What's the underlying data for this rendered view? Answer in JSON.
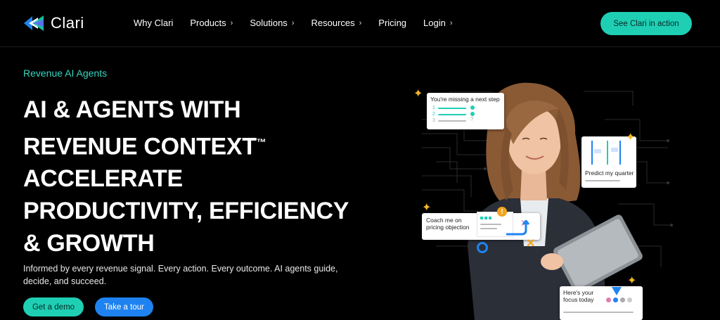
{
  "nav": {
    "logo_text": "Clari",
    "items": [
      {
        "label": "Why Clari",
        "has_chevron": false
      },
      {
        "label": "Products",
        "has_chevron": true
      },
      {
        "label": "Solutions",
        "has_chevron": true
      },
      {
        "label": "Resources",
        "has_chevron": true
      },
      {
        "label": "Pricing",
        "has_chevron": false
      },
      {
        "label": "Login",
        "has_chevron": true
      }
    ],
    "cta_label": "See Clari in action"
  },
  "hero": {
    "eyebrow": "Revenue AI Agents",
    "headline_lines": [
      "AI & AGENTS WITH",
      "REVENUE CONTEXT",
      "ACCELERATE",
      "PRODUCTIVITY, EFFICIENCY",
      "& GROWTH"
    ],
    "trademark": "™",
    "subtext": "Informed by every revenue signal. Every action. Every outcome. AI agents guide, decide, and succeed.",
    "primary_button": "Get a demo",
    "secondary_button": "Take a tour"
  },
  "visual": {
    "cards": {
      "next_step": "You're missing a next step",
      "predict": "Predict my quarter",
      "coach": "Coach me on pricing objection",
      "focus": "Here's your focus today"
    },
    "checklist_numbers": [
      "1",
      "2",
      "3"
    ],
    "question_mark": "?",
    "alert_mark": "!"
  },
  "colors": {
    "accent_teal": "#1fcfb4",
    "accent_blue": "#1e83f0",
    "background": "#000000",
    "spark_gold": "#f2b524"
  }
}
